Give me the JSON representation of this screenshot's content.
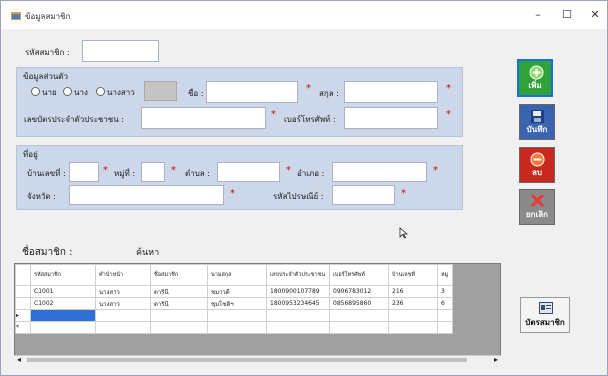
{
  "window": {
    "title": "ข้อมูลสมาชิก",
    "min_glyph": "–",
    "max_glyph": "☐",
    "close_glyph": "✕"
  },
  "member_code": {
    "label": "รหัสสมาชิก :",
    "value": ""
  },
  "personal": {
    "heading": "ข้อมูลส่วนตัว",
    "radio_mr": "นาย",
    "radio_mrs": "นาง",
    "radio_miss": "นางสาว",
    "name_label": "ชื่อ :",
    "surname_label": "สกุล :",
    "id_label": "เลขบัตรประจำตัวประชาชน :",
    "phone_label": "เบอร์โทรศัพท์ :",
    "req": "*"
  },
  "address": {
    "heading": "ที่อยู่",
    "house_label": "บ้านเลขที่ :",
    "moo_label": "หมู่ที่ :",
    "tambon_label": "ตำบล :",
    "amphoe_label": "อำเภอ :",
    "province_label": "จังหวัด :",
    "zip_label": "รหัสไปรษณีย์ :",
    "req": "*"
  },
  "search": {
    "label": "ชื่อสมาชิก :",
    "button": "ค้นหา"
  },
  "buttons": {
    "add": "เพิ่ม",
    "save": "บันทึก",
    "delete": "ลบ",
    "cancel": "ยกเลิก",
    "card": "บัตรสมาชิก"
  },
  "colors": {
    "add": "#2fa33a",
    "save": "#3a64b0",
    "delete": "#c8281e",
    "cancel": "#8a8a8a",
    "panel": "#ccd7ea"
  },
  "table": {
    "columns": [
      "รหัสสมาชิก",
      "คำนำหน้า",
      "ชื่อสมาชิก",
      "นามสกุล",
      "เลขประจำตัวประชาชน",
      "เบอร์โทรศัพท์",
      "บ้านเลขที่",
      "หมู"
    ],
    "rows": [
      [
        "C1001",
        "นางสาว",
        "ดารินี",
        "ชมาวดี",
        "1800900107789",
        "0906783012",
        "216",
        "3"
      ],
      [
        "C1002",
        "นางสาว",
        "ดารินี",
        "ชุมโชติฯ",
        "1800953234645",
        "0856895860",
        "236",
        "6"
      ]
    ],
    "row_markers": [
      "",
      "",
      "▸",
      "*"
    ]
  },
  "scroll": {
    "left": "◂",
    "right": "▸"
  }
}
